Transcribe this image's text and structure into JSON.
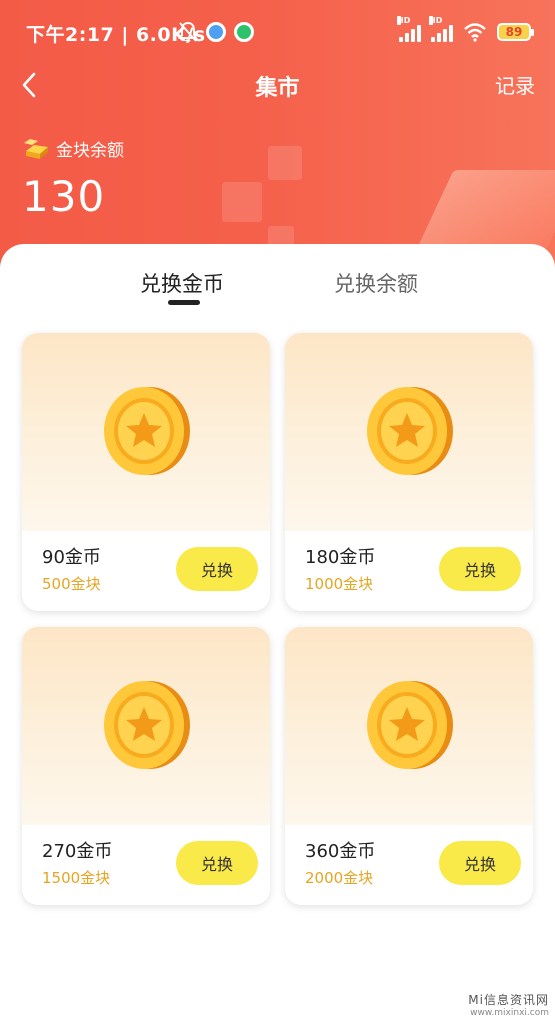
{
  "status_bar": {
    "time": "下午2:17",
    "speed": "6.0K/s",
    "battery": "89",
    "network_label": "HD"
  },
  "nav": {
    "title": "集市",
    "record_label": "记录"
  },
  "balance": {
    "label": "金块余额",
    "value": "130"
  },
  "tabs": [
    {
      "label": "兑换金币",
      "active": true
    },
    {
      "label": "兑换余额",
      "active": false
    }
  ],
  "items": [
    {
      "amount": "90金币",
      "price": "500金块",
      "button": "兑换"
    },
    {
      "amount": "180金币",
      "price": "1000金块",
      "button": "兑换"
    },
    {
      "amount": "270金币",
      "price": "1500金块",
      "button": "兑换"
    },
    {
      "amount": "360金币",
      "price": "2000金块",
      "button": "兑换"
    }
  ],
  "watermark": {
    "line1": "Mi信息资讯网",
    "line2": "www.mixinxi.com"
  },
  "colors": {
    "header_red": "#f35b47",
    "button_yellow": "#f9ea4a",
    "price_gold": "#e6a523"
  }
}
